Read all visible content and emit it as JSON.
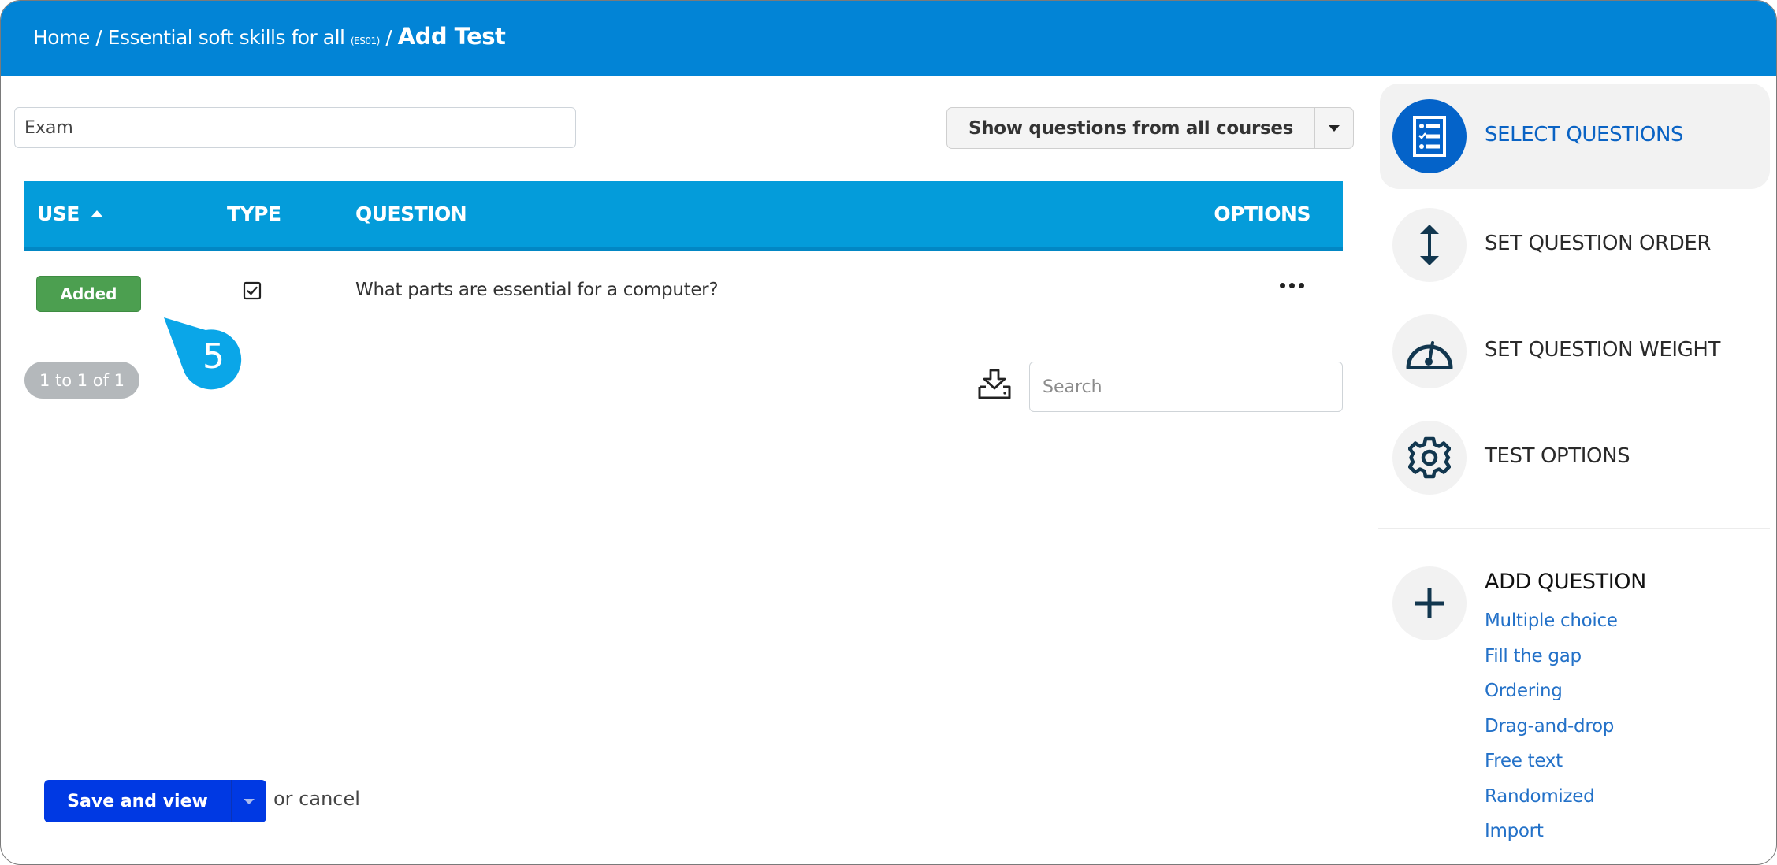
{
  "breadcrumb": {
    "home": "Home",
    "separator": "/",
    "course": "Essential soft skills for all",
    "course_code": "(ES01)",
    "current": "Add Test"
  },
  "form": {
    "test_name_value": "Exam",
    "filter_label": "Show questions from all courses"
  },
  "table": {
    "columns": {
      "use": "USE",
      "type": "TYPE",
      "question": "QUESTION",
      "options": "OPTIONS"
    },
    "sort": {
      "column": "USE",
      "direction": "ascending"
    },
    "rows": [
      {
        "use_label": "Added",
        "type_icon": "checkbox-checked-icon",
        "question": "What parts are essential for a computer?",
        "options_icon": "more-horizontal-icon"
      }
    ],
    "pagination": "1 to 1 of 1",
    "search_placeholder": "Search",
    "search_value": ""
  },
  "callout": {
    "number": "5"
  },
  "footer": {
    "save_label": "Save and view",
    "cancel_text": "or cancel"
  },
  "sidebar": {
    "steps": [
      {
        "label": "SELECT QUESTIONS",
        "icon": "checklist-icon",
        "active": true
      },
      {
        "label": "SET QUESTION ORDER",
        "icon": "vertical-arrows-icon",
        "active": false
      },
      {
        "label": "SET QUESTION WEIGHT",
        "icon": "gauge-icon",
        "active": false
      },
      {
        "label": "TEST OPTIONS",
        "icon": "gear-icon",
        "active": false
      }
    ],
    "add_question": {
      "title": "ADD QUESTION",
      "icon": "plus-icon",
      "links": [
        "Multiple choice",
        "Fill the gap",
        "Ordering",
        "Drag-and-drop",
        "Free text",
        "Randomized",
        "Import"
      ]
    }
  },
  "colors": {
    "header_bg": "#0284d6",
    "table_header_bg": "#049cda",
    "added_green": "#4c9f50",
    "active_blue": "#0463c9",
    "save_blue": "#0039e3",
    "callout_blue": "#0aa6e8",
    "link_blue": "#2371c8"
  }
}
